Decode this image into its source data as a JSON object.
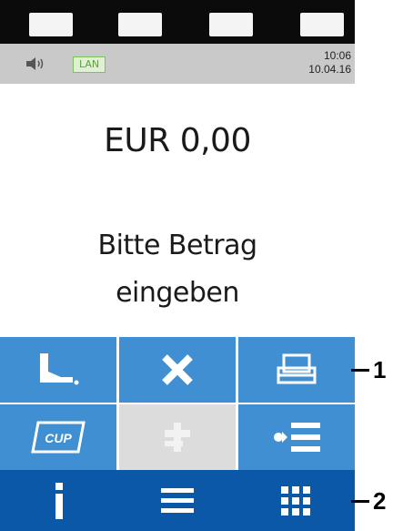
{
  "status_bar": {
    "speaker_icon": "speaker-icon",
    "connection_badge": "LAN",
    "time": "10:06",
    "date": "10.04.16"
  },
  "display": {
    "amount": "EUR 0,00",
    "prompt_line1": "Bitte Betrag",
    "prompt_line2": "eingeben"
  },
  "keypad": {
    "row1": [
      "receipt-icon",
      "cancel-x-icon",
      "printer-icon"
    ],
    "row2": [
      "cup-card-icon",
      "disabled-function-icon",
      "add-to-list-icon"
    ],
    "cup_label": "CUP"
  },
  "nav": [
    "info-icon",
    "menu-icon",
    "keypad-grid-icon"
  ],
  "callouts": {
    "one": "1",
    "two": "2"
  },
  "colors": {
    "key_blue": "#3f8fd2",
    "nav_blue": "#0b57a8",
    "status_gray": "#c9c9c9",
    "disabled_gray": "#dcdcdc",
    "lan_green": "#5aa23a"
  }
}
